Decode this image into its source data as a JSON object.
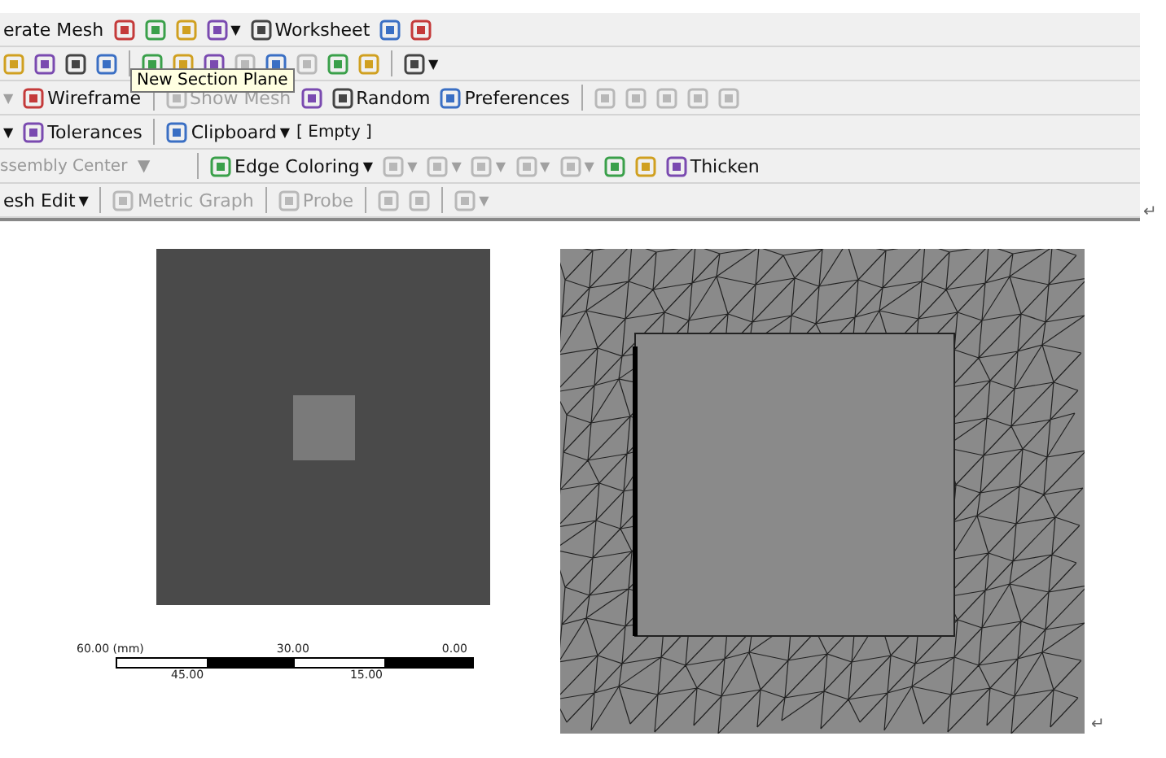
{
  "toolbar": {
    "rows": [
      {
        "items": [
          {
            "kind": "tool",
            "label": "erate Mesh",
            "icon": false,
            "disabled": false
          },
          {
            "kind": "tool",
            "disabled": false
          },
          {
            "kind": "tool",
            "disabled": false
          },
          {
            "kind": "tool",
            "disabled": false
          },
          {
            "kind": "tool",
            "arrow": "▼",
            "disabled": false
          },
          {
            "kind": "tool",
            "label": "Worksheet",
            "disabled": false
          },
          {
            "kind": "tool",
            "disabled": false
          },
          {
            "kind": "tool",
            "disabled": false
          }
        ]
      },
      {
        "items": [
          {
            "kind": "tool",
            "disabled": false
          },
          {
            "kind": "tool",
            "disabled": false
          },
          {
            "kind": "tool",
            "disabled": false
          },
          {
            "kind": "tool",
            "disabled": false
          },
          {
            "kind": "separator"
          },
          {
            "kind": "tool",
            "disabled": false
          },
          {
            "kind": "tool",
            "disabled": false
          },
          {
            "kind": "tool",
            "disabled": false
          },
          {
            "kind": "tool",
            "disabled": true
          },
          {
            "kind": "tool",
            "disabled": false
          },
          {
            "kind": "tool",
            "disabled": true
          },
          {
            "kind": "tool",
            "disabled": false
          },
          {
            "kind": "tool",
            "disabled": false
          },
          {
            "kind": "separator"
          },
          {
            "kind": "tool",
            "arrow": "▼",
            "disabled": false
          }
        ]
      },
      {
        "items": [
          {
            "kind": "arrow",
            "arrow": "▼",
            "disabled": true
          },
          {
            "kind": "tool",
            "label": "Wireframe",
            "disabled": false
          },
          {
            "kind": "separator"
          },
          {
            "kind": "tool",
            "label": "Show Mesh",
            "disabled": true
          },
          {
            "kind": "tool",
            "disabled": false
          },
          {
            "kind": "tool",
            "label": "Random",
            "disabled": false
          },
          {
            "kind": "tool",
            "label": "Preferences",
            "disabled": false
          },
          {
            "kind": "separator"
          },
          {
            "kind": "tool",
            "disabled": true
          },
          {
            "kind": "tool",
            "disabled": true
          },
          {
            "kind": "tool",
            "disabled": true
          },
          {
            "kind": "tool",
            "disabled": true
          },
          {
            "kind": "tool",
            "disabled": true
          }
        ]
      },
      {
        "items": [
          {
            "kind": "arrow",
            "arrow": "▼",
            "disabled": false
          },
          {
            "kind": "tool",
            "label": "Tolerances",
            "disabled": false
          },
          {
            "kind": "separator"
          },
          {
            "kind": "tool",
            "label": "Clipboard",
            "arrow": "▼",
            "disabled": false
          },
          {
            "kind": "note",
            "label": "[ Empty ]"
          }
        ]
      },
      {
        "items": [
          {
            "kind": "combo",
            "label": "ssembly Center",
            "arrow": "▼",
            "disabled": true
          },
          {
            "kind": "separator"
          },
          {
            "kind": "tool",
            "label": "Edge Coloring",
            "arrow": "▼",
            "disabled": false
          },
          {
            "kind": "tool",
            "arrow": "▼",
            "disabled": true
          },
          {
            "kind": "tool",
            "arrow": "▼",
            "disabled": true
          },
          {
            "kind": "tool",
            "arrow": "▼",
            "disabled": true
          },
          {
            "kind": "tool",
            "arrow": "▼",
            "disabled": true
          },
          {
            "kind": "tool",
            "arrow": "▼",
            "disabled": true
          },
          {
            "kind": "tool",
            "disabled": false
          },
          {
            "kind": "tool",
            "disabled": false
          },
          {
            "kind": "tool",
            "label": "Thicken",
            "disabled": false
          }
        ]
      },
      {
        "items": [
          {
            "kind": "tool",
            "label": "esh Edit",
            "icon": false,
            "arrow": "▼",
            "disabled": false
          },
          {
            "kind": "separator"
          },
          {
            "kind": "tool",
            "label": "Metric Graph",
            "disabled": true
          },
          {
            "kind": "separator"
          },
          {
            "kind": "tool",
            "label": "Probe",
            "disabled": true
          },
          {
            "kind": "separator"
          },
          {
            "kind": "tool",
            "disabled": true
          },
          {
            "kind": "tool",
            "disabled": true
          },
          {
            "kind": "separator"
          },
          {
            "kind": "tool",
            "arrow": "▼",
            "disabled": true
          }
        ]
      }
    ]
  },
  "tooltip": {
    "text": "New Section Plane"
  },
  "paragraph_marks": [
    "↵",
    "↵"
  ],
  "scale_bar": {
    "top_labels": [
      "60.00 (mm)",
      "30.00",
      "0.00"
    ],
    "bottom_labels": [
      "45.00",
      "15.00"
    ]
  }
}
